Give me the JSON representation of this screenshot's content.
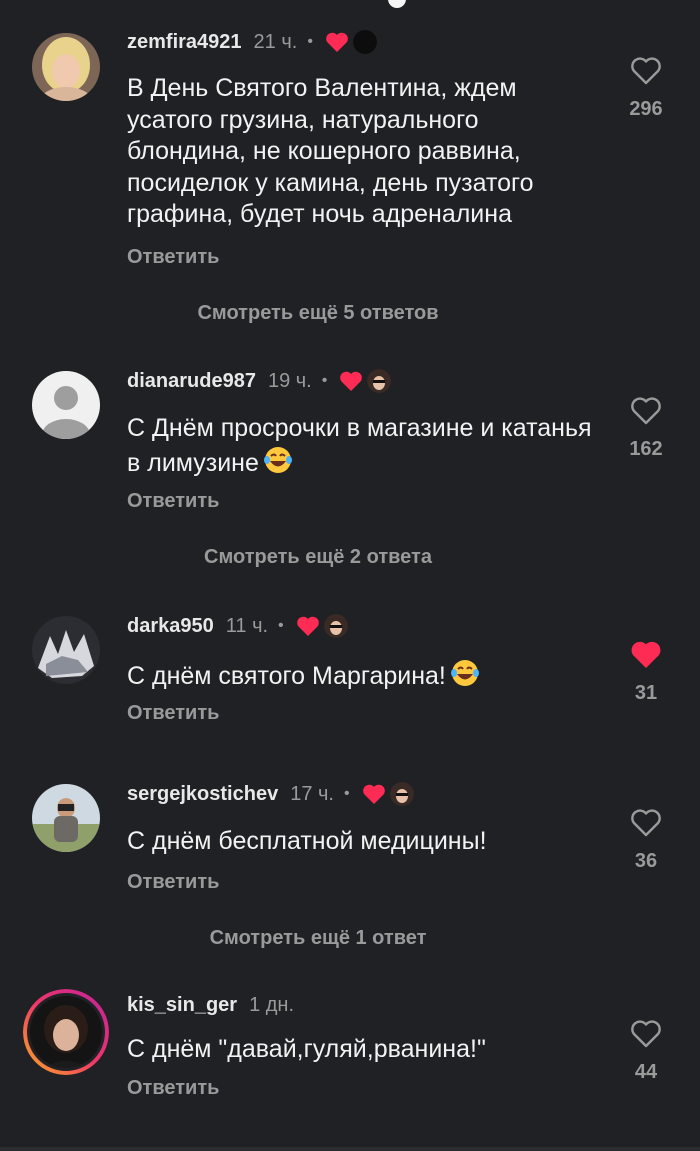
{
  "comments": [
    {
      "username": "zemfira4921",
      "time": "21 ч.",
      "text": "В День Святого Валентина, ждем усатого грузина, натурального блондина, не кошерного раввина, посиделок у камина, день пузатого графина, будет ночь адреналина",
      "reply": "Ответить",
      "likes": "296",
      "liked": false,
      "more": "Смотреть ещё 5 ответов"
    },
    {
      "username": "dianarude987",
      "time": "19 ч.",
      "text": "С Днём просрочки в магазине и катанья в лимузине",
      "reply": "Ответить",
      "likes": "162",
      "liked": false,
      "more": "Смотреть ещё 2 ответа"
    },
    {
      "username": "darka950",
      "time": "11 ч.",
      "text": "С днём святого Маргарина!",
      "reply": "Ответить",
      "likes": "31",
      "liked": true
    },
    {
      "username": "sergejkostichev",
      "time": "17 ч.",
      "text": "С днём бесплатной медицины!",
      "reply": "Ответить",
      "likes": "36",
      "liked": false,
      "more": "Смотреть ещё 1 ответ"
    },
    {
      "username": "kis_sin_ger",
      "time": "1 дн.",
      "text": "С днём \"давай,гуляй,рванина!\"",
      "reply": "Ответить",
      "likes": "44",
      "liked": false
    }
  ],
  "icons": {
    "like": "heart-outline-icon",
    "liked": "heart-filled-icon",
    "emoji": "tears-of-joy-emoji",
    "separator": "•"
  },
  "colors": {
    "background": "#202124",
    "liked_red": "#fe2c55",
    "muted_text": "#9a9a9a"
  }
}
